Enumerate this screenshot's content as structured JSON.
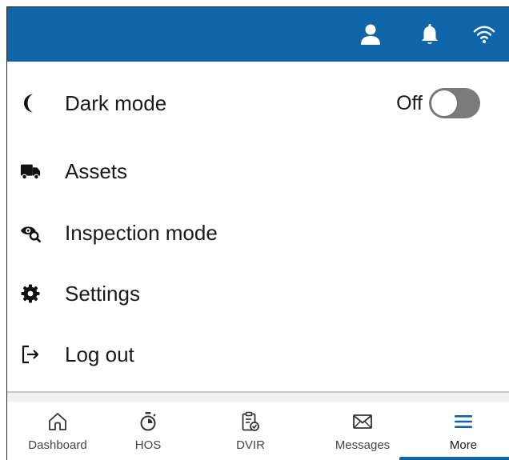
{
  "header": {
    "icons": [
      "user-icon",
      "bell-icon",
      "wifi-icon"
    ],
    "bar_color": "#0f65a8"
  },
  "menu": {
    "items": [
      {
        "label": "Dark mode",
        "icon": "moon-icon",
        "toggle_state": "Off"
      },
      {
        "label": "Assets",
        "icon": "truck-icon"
      },
      {
        "label": "Inspection mode",
        "icon": "inspection-eye-icon"
      },
      {
        "label": "Settings",
        "icon": "gear-icon"
      },
      {
        "label": "Log out",
        "icon": "logout-icon"
      }
    ]
  },
  "bottom_nav": {
    "items": [
      {
        "label": "Dashboard",
        "icon": "home-icon"
      },
      {
        "label": "HOS",
        "icon": "stopwatch-icon"
      },
      {
        "label": "DVIR",
        "icon": "clipboard-check-icon"
      },
      {
        "label": "Messages",
        "icon": "envelope-icon"
      },
      {
        "label": "More",
        "icon": "hamburger-menu-icon"
      }
    ],
    "active": "More",
    "accent_color": "#0f65a8"
  }
}
